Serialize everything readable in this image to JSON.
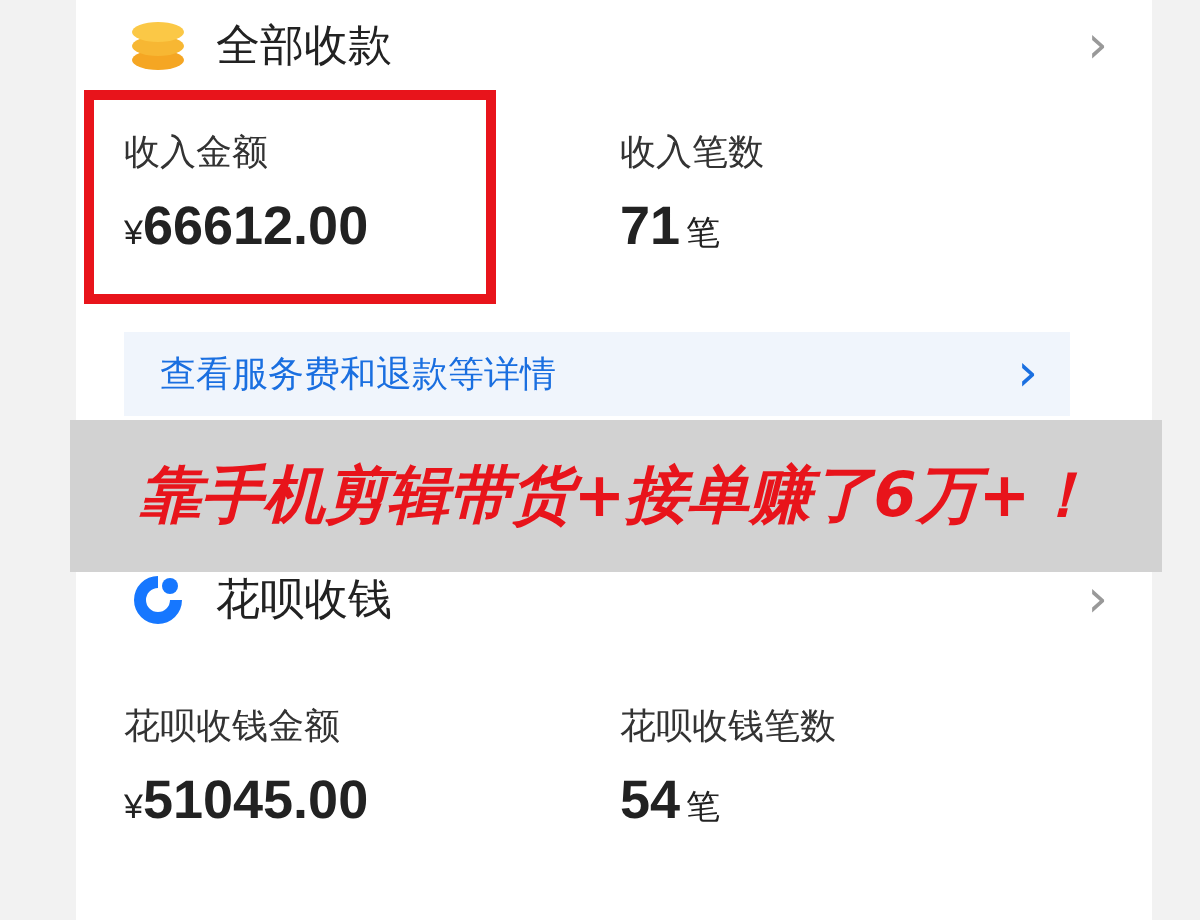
{
  "sections": [
    {
      "kind": "coins",
      "title": "全部收款",
      "chevron": "›",
      "stats": [
        {
          "label": "收入金额",
          "prefix": "¥",
          "value": "66612.00",
          "highlighted": true
        },
        {
          "label": "收入笔数",
          "value": "71",
          "suffix": "笔",
          "highlighted": false
        }
      ],
      "link": {
        "text": "查看服务费和退款等详情",
        "chevron": "›"
      }
    },
    {
      "kind": "huabei",
      "title": "花呗收钱",
      "chevron": "›",
      "stats": [
        {
          "label": "花呗收钱金额",
          "prefix": "¥",
          "value": "51045.00",
          "highlighted": false
        },
        {
          "label": "花呗收钱笔数",
          "value": "54",
          "suffix": "笔",
          "highlighted": false
        }
      ]
    }
  ],
  "banner": {
    "text": "靠手机剪辑带货+接单赚了6万+！"
  }
}
